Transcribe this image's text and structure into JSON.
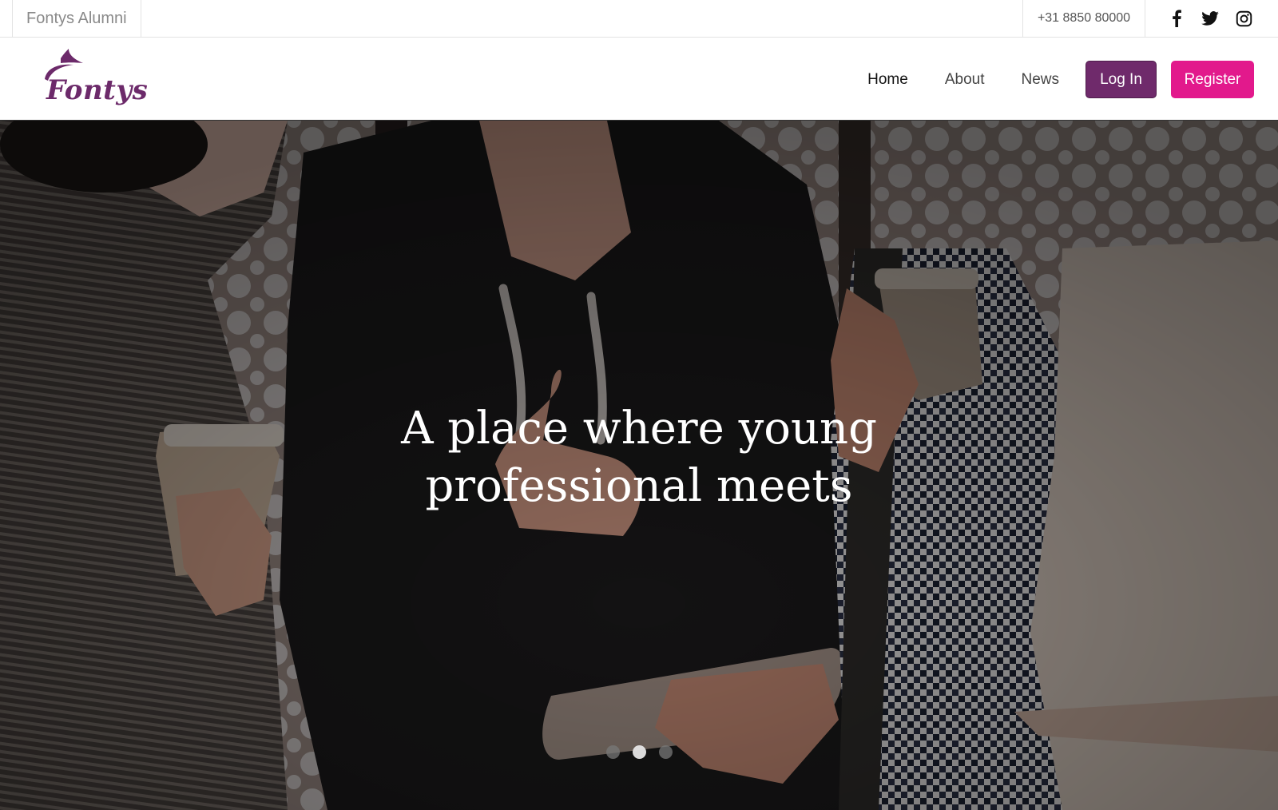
{
  "topbar": {
    "site_name": "Fontys Alumni",
    "phone": "+31 8850 80000",
    "social": [
      {
        "icon": "facebook-icon"
      },
      {
        "icon": "twitter-icon"
      },
      {
        "icon": "instagram-icon"
      }
    ]
  },
  "navbar": {
    "logo_text": "Fontys",
    "links": [
      {
        "label": "Home",
        "active": true
      },
      {
        "label": "About",
        "active": false
      },
      {
        "label": "News",
        "active": false
      }
    ],
    "login_label": "Log In",
    "register_label": "Register"
  },
  "hero": {
    "caption": "A place where young professional meets",
    "slides_total": 3,
    "active_slide": 2
  },
  "colors": {
    "brand_purple": "#6f2a6b",
    "brand_pink": "#e2198c"
  }
}
